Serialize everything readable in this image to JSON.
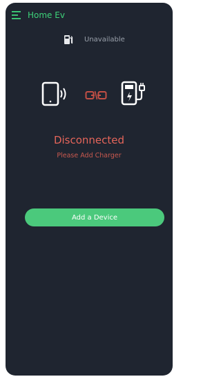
{
  "header": {
    "title": "Home Ev",
    "menu_icon": "hamburger-menu-icon"
  },
  "status": {
    "icon": "fuel-pump-icon",
    "text": "Unavailable"
  },
  "connection": {
    "device_icon": "tablet-wireless-icon",
    "link_icon": "broken-link-icon",
    "charger_icon": "ev-charger-icon",
    "title": "Disconnected",
    "subtitle": "Please Add Charger"
  },
  "actions": {
    "add_device_label": "Add a Device"
  },
  "colors": {
    "accent_green": "#3ed37a",
    "button_green": "#4bc97c",
    "error_red": "#e5655a",
    "background": "#1f2530"
  }
}
